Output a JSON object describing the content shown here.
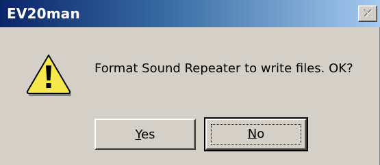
{
  "window": {
    "title": "EV20man",
    "close_icon": "close-x-icon"
  },
  "message": {
    "icon": "warning-icon",
    "text": "Format Sound Repeater to write files. OK?"
  },
  "buttons": {
    "yes": {
      "label_first": "Y",
      "label_rest": "es"
    },
    "no": {
      "label_first": "N",
      "label_rest": "o"
    }
  },
  "colors": {
    "title_gradient_start": "#0a246a",
    "title_gradient_end": "#a6caf0",
    "dialog_face": "#d4d0c8",
    "warning_fill": "#f7e74a"
  }
}
